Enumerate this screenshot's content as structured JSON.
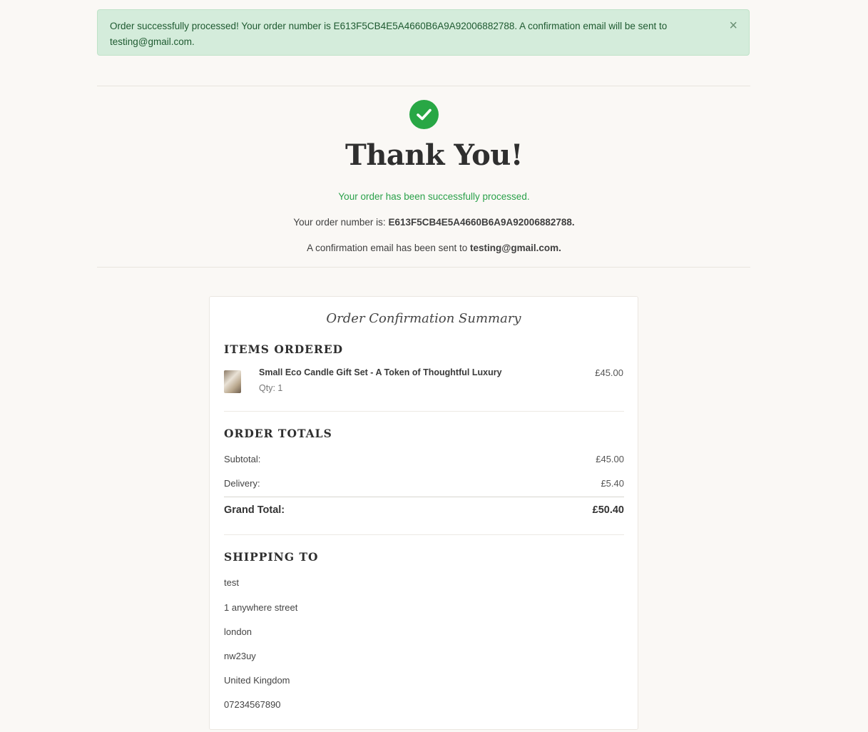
{
  "alert": {
    "message": "Order successfully processed! Your order number is E613F5CB4E5A4660B6A9A92006882788. A confirmation email will be sent to testing@gmail.com.",
    "close_label": "×"
  },
  "hero": {
    "title": "Thank You!",
    "success_text": "Your order has been successfully processed.",
    "order_number_prefix": "Your order number is: ",
    "order_number": "E613F5CB4E5A4660B6A9A92006882788.",
    "email_prefix": "A confirmation email has been sent to ",
    "email": "testing@gmail.com."
  },
  "summary": {
    "title": "Order Confirmation Summary",
    "items_heading": "Items Ordered",
    "items": [
      {
        "name": "Small Eco Candle Gift Set - A Token of Thoughtful Luxury",
        "qty": "Qty: 1",
        "price": "£45.00"
      }
    ],
    "totals_heading": "Order Totals",
    "subtotal_label": "Subtotal:",
    "subtotal_value": "£45.00",
    "delivery_label": "Delivery:",
    "delivery_value": "£5.40",
    "grand_label": "Grand Total:",
    "grand_value": "£50.40",
    "shipping_heading": "Shipping To",
    "shipping": {
      "name": "test",
      "street": "1 anywhere street",
      "city": "london",
      "postcode": "nw23uy",
      "country": "United Kingdom",
      "phone": "07234567890"
    }
  },
  "colors": {
    "background": "#faf8f5",
    "alert_bg": "#d4ecdb",
    "success_green": "#28a745",
    "text_dark": "#2f2f2f"
  },
  "icons": {
    "success": "check-circle-icon",
    "close": "close-icon",
    "product": "product-thumbnail"
  }
}
